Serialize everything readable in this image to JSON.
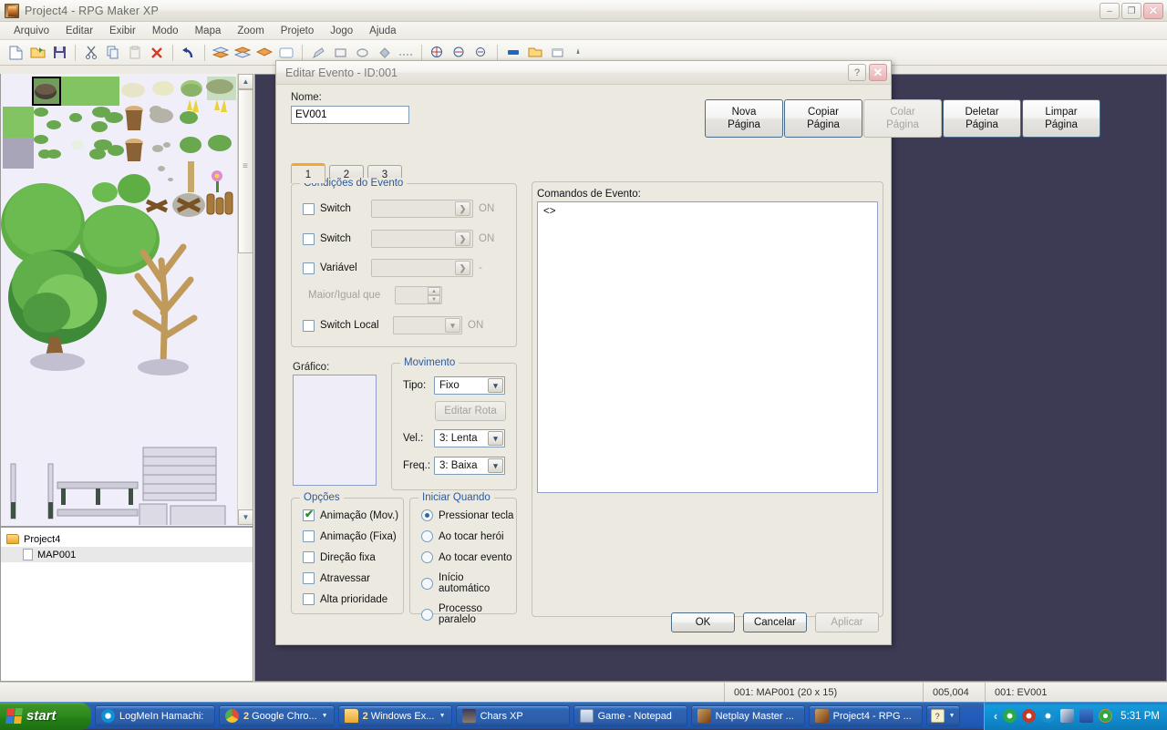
{
  "window": {
    "title": "Project4 - RPG Maker XP",
    "icon": "rpgmaker-icon",
    "buttons": {
      "minimize": "–",
      "maximize": "❐",
      "close": "✕"
    }
  },
  "menubar": {
    "items": [
      "Arquivo",
      "Editar",
      "Exibir",
      "Modo",
      "Mapa",
      "Zoom",
      "Projeto",
      "Jogo",
      "Ajuda"
    ]
  },
  "toolbar": {
    "icons": [
      "new-icon",
      "open-icon",
      "save-icon",
      "cut-icon",
      "copy-icon",
      "paste-icon",
      "delete-icon",
      "undo-icon",
      "layer1-icon",
      "layer2-icon",
      "layer3-icon",
      "event-layer-icon",
      "pencil-icon",
      "rect-icon",
      "ellipse-icon",
      "fill-icon",
      "select-icon",
      "shade-icon",
      "zoom1-icon",
      "zoom2-icon",
      "zoom3-icon",
      "database-icon",
      "materials-icon",
      "script-icon",
      "play-icon"
    ]
  },
  "tilepanel": {
    "name": "tileset-palette",
    "selected_tile_index": 1,
    "scrollbar": {
      "up": "▲",
      "down": "▼"
    }
  },
  "tree": {
    "root": "Project4",
    "children": [
      "MAP001"
    ]
  },
  "statusbar": {
    "map": "001: MAP001 (20 x 15)",
    "coords": "005,004",
    "event": "001: EV001"
  },
  "dialog": {
    "title": "Editar Evento - ID:001",
    "help_button": "?",
    "close_button": "✕",
    "name_label": "Nome:",
    "name_value": "EV001",
    "page_buttons": [
      {
        "line1": "Nova",
        "line2": "Página",
        "disabled": false
      },
      {
        "line1": "Copiar",
        "line2": "Página",
        "disabled": false
      },
      {
        "line1": "Colar",
        "line2": "Página",
        "disabled": true
      },
      {
        "line1": "Deletar",
        "line2": "Página",
        "disabled": false
      },
      {
        "line1": "Limpar",
        "line2": "Página",
        "disabled": false
      }
    ],
    "tabs": [
      {
        "label": "1",
        "active": true
      },
      {
        "label": "2",
        "active": false
      },
      {
        "label": "3",
        "active": false
      }
    ],
    "conditions": {
      "legend": "Condições do Evento",
      "rows": [
        {
          "label": "Switch",
          "checked": false,
          "value": "",
          "suffix": "ON"
        },
        {
          "label": "Switch",
          "checked": false,
          "value": "",
          "suffix": "ON"
        },
        {
          "label": "Variável",
          "checked": false,
          "value": "",
          "suffix": "-"
        },
        {
          "label": "Maior/Igual que",
          "checked": null,
          "value": "",
          "suffix": ""
        },
        {
          "label": "Switch Local",
          "checked": false,
          "value": "",
          "suffix": "ON"
        }
      ]
    },
    "graphic": {
      "label": "Gráfico:",
      "value": ""
    },
    "movement": {
      "legend": "Movimento",
      "type_label": "Tipo:",
      "type_value": "Fixo",
      "edit_route_label": "Editar Rota",
      "speed_label": "Vel.:",
      "speed_value": "3: Lenta",
      "freq_label": "Freq.:",
      "freq_value": "3: Baixa"
    },
    "options": {
      "legend": "Opções",
      "items": [
        {
          "label": "Animação (Mov.)",
          "checked": true
        },
        {
          "label": "Animação (Fixa)",
          "checked": false
        },
        {
          "label": "Direção fixa",
          "checked": false
        },
        {
          "label": "Atravessar",
          "checked": false
        },
        {
          "label": "Alta prioridade",
          "checked": false
        }
      ]
    },
    "trigger": {
      "legend": "Iniciar Quando",
      "items": [
        {
          "label": "Pressionar tecla",
          "selected": true
        },
        {
          "label": "Ao tocar herói",
          "selected": false
        },
        {
          "label": "Ao tocar evento",
          "selected": false
        },
        {
          "label": "Início automático",
          "selected": false
        },
        {
          "label": "Processo paralelo",
          "selected": false
        }
      ]
    },
    "commands": {
      "label": "Comandos de Evento:",
      "content": "<>"
    },
    "footer": [
      {
        "label": "OK",
        "disabled": false
      },
      {
        "label": "Cancelar",
        "disabled": false
      },
      {
        "label": "Aplicar",
        "disabled": true
      }
    ]
  },
  "taskbar": {
    "start_label": "start",
    "buttons": [
      {
        "icon": "hamachi-icon",
        "count": "",
        "label": "LogMeIn Hamachi:",
        "has_dropdown": false
      },
      {
        "icon": "chrome-icon",
        "count": "2",
        "label": "Google Chro...",
        "has_dropdown": true
      },
      {
        "icon": "explorer-icon",
        "count": "2",
        "label": "Windows Ex...",
        "has_dropdown": true
      },
      {
        "icon": "charsxp-icon",
        "count": "",
        "label": "Chars XP",
        "has_dropdown": false
      },
      {
        "icon": "notepad-icon",
        "count": "",
        "label": "Game - Notepad",
        "has_dropdown": false
      },
      {
        "icon": "rpgmaker-icon",
        "count": "",
        "label": "Netplay Master ...",
        "has_dropdown": false
      },
      {
        "icon": "rpgmaker-icon",
        "count": "",
        "label": "Project4 - RPG ...",
        "has_dropdown": false
      }
    ],
    "tray": {
      "chevron": "‹",
      "icons": [
        "help-icon",
        "network-icon",
        "phone-icon",
        "shield-icon",
        "hamachi-icon",
        "rocket-icon",
        "monitor-icon",
        "update-icon"
      ],
      "clock": "5:31 PM"
    }
  },
  "colors": {
    "accent_blue": "#2b5a9b",
    "map_background": "#3d3b54",
    "tile_background": "#f0eff9",
    "tab_highlight": "#f0a830",
    "taskbar_blue": "#245dbd",
    "start_green": "#2e8a1c"
  }
}
